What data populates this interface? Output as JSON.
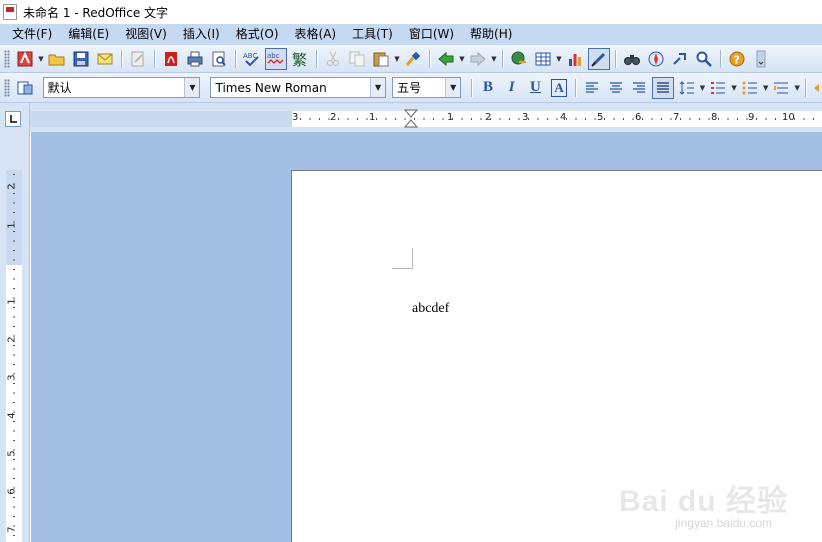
{
  "window": {
    "title": "未命名 1 - RedOffice 文字"
  },
  "menu": {
    "items": [
      "文件(F)",
      "编辑(E)",
      "视图(V)",
      "插入(I)",
      "格式(O)",
      "表格(A)",
      "工具(T)",
      "窗口(W)",
      "帮助(H)"
    ]
  },
  "format_bar": {
    "style_value": "默认",
    "font_value": "Times New Roman",
    "size_value": "五号",
    "bold_label": "B",
    "italic_label": "I",
    "underline_label": "U",
    "shadow_label": "A"
  },
  "ruler": {
    "horizontal_labels": [
      "3",
      "2",
      "1",
      "1",
      "2",
      "3",
      "4",
      "5",
      "6",
      "7",
      "8",
      "9",
      "10"
    ],
    "vertical_labels": [
      "2",
      "1",
      "1",
      "2",
      "3",
      "4",
      "5",
      "6",
      "7"
    ]
  },
  "document": {
    "text": "abcdef"
  },
  "watermark": {
    "logo": "Bai du 经验",
    "url": "jingyan.baidu.com"
  },
  "colors": {
    "menubar": "#c6d9f3",
    "workspace": "#a3bfe6",
    "accent": "#2953a6"
  }
}
